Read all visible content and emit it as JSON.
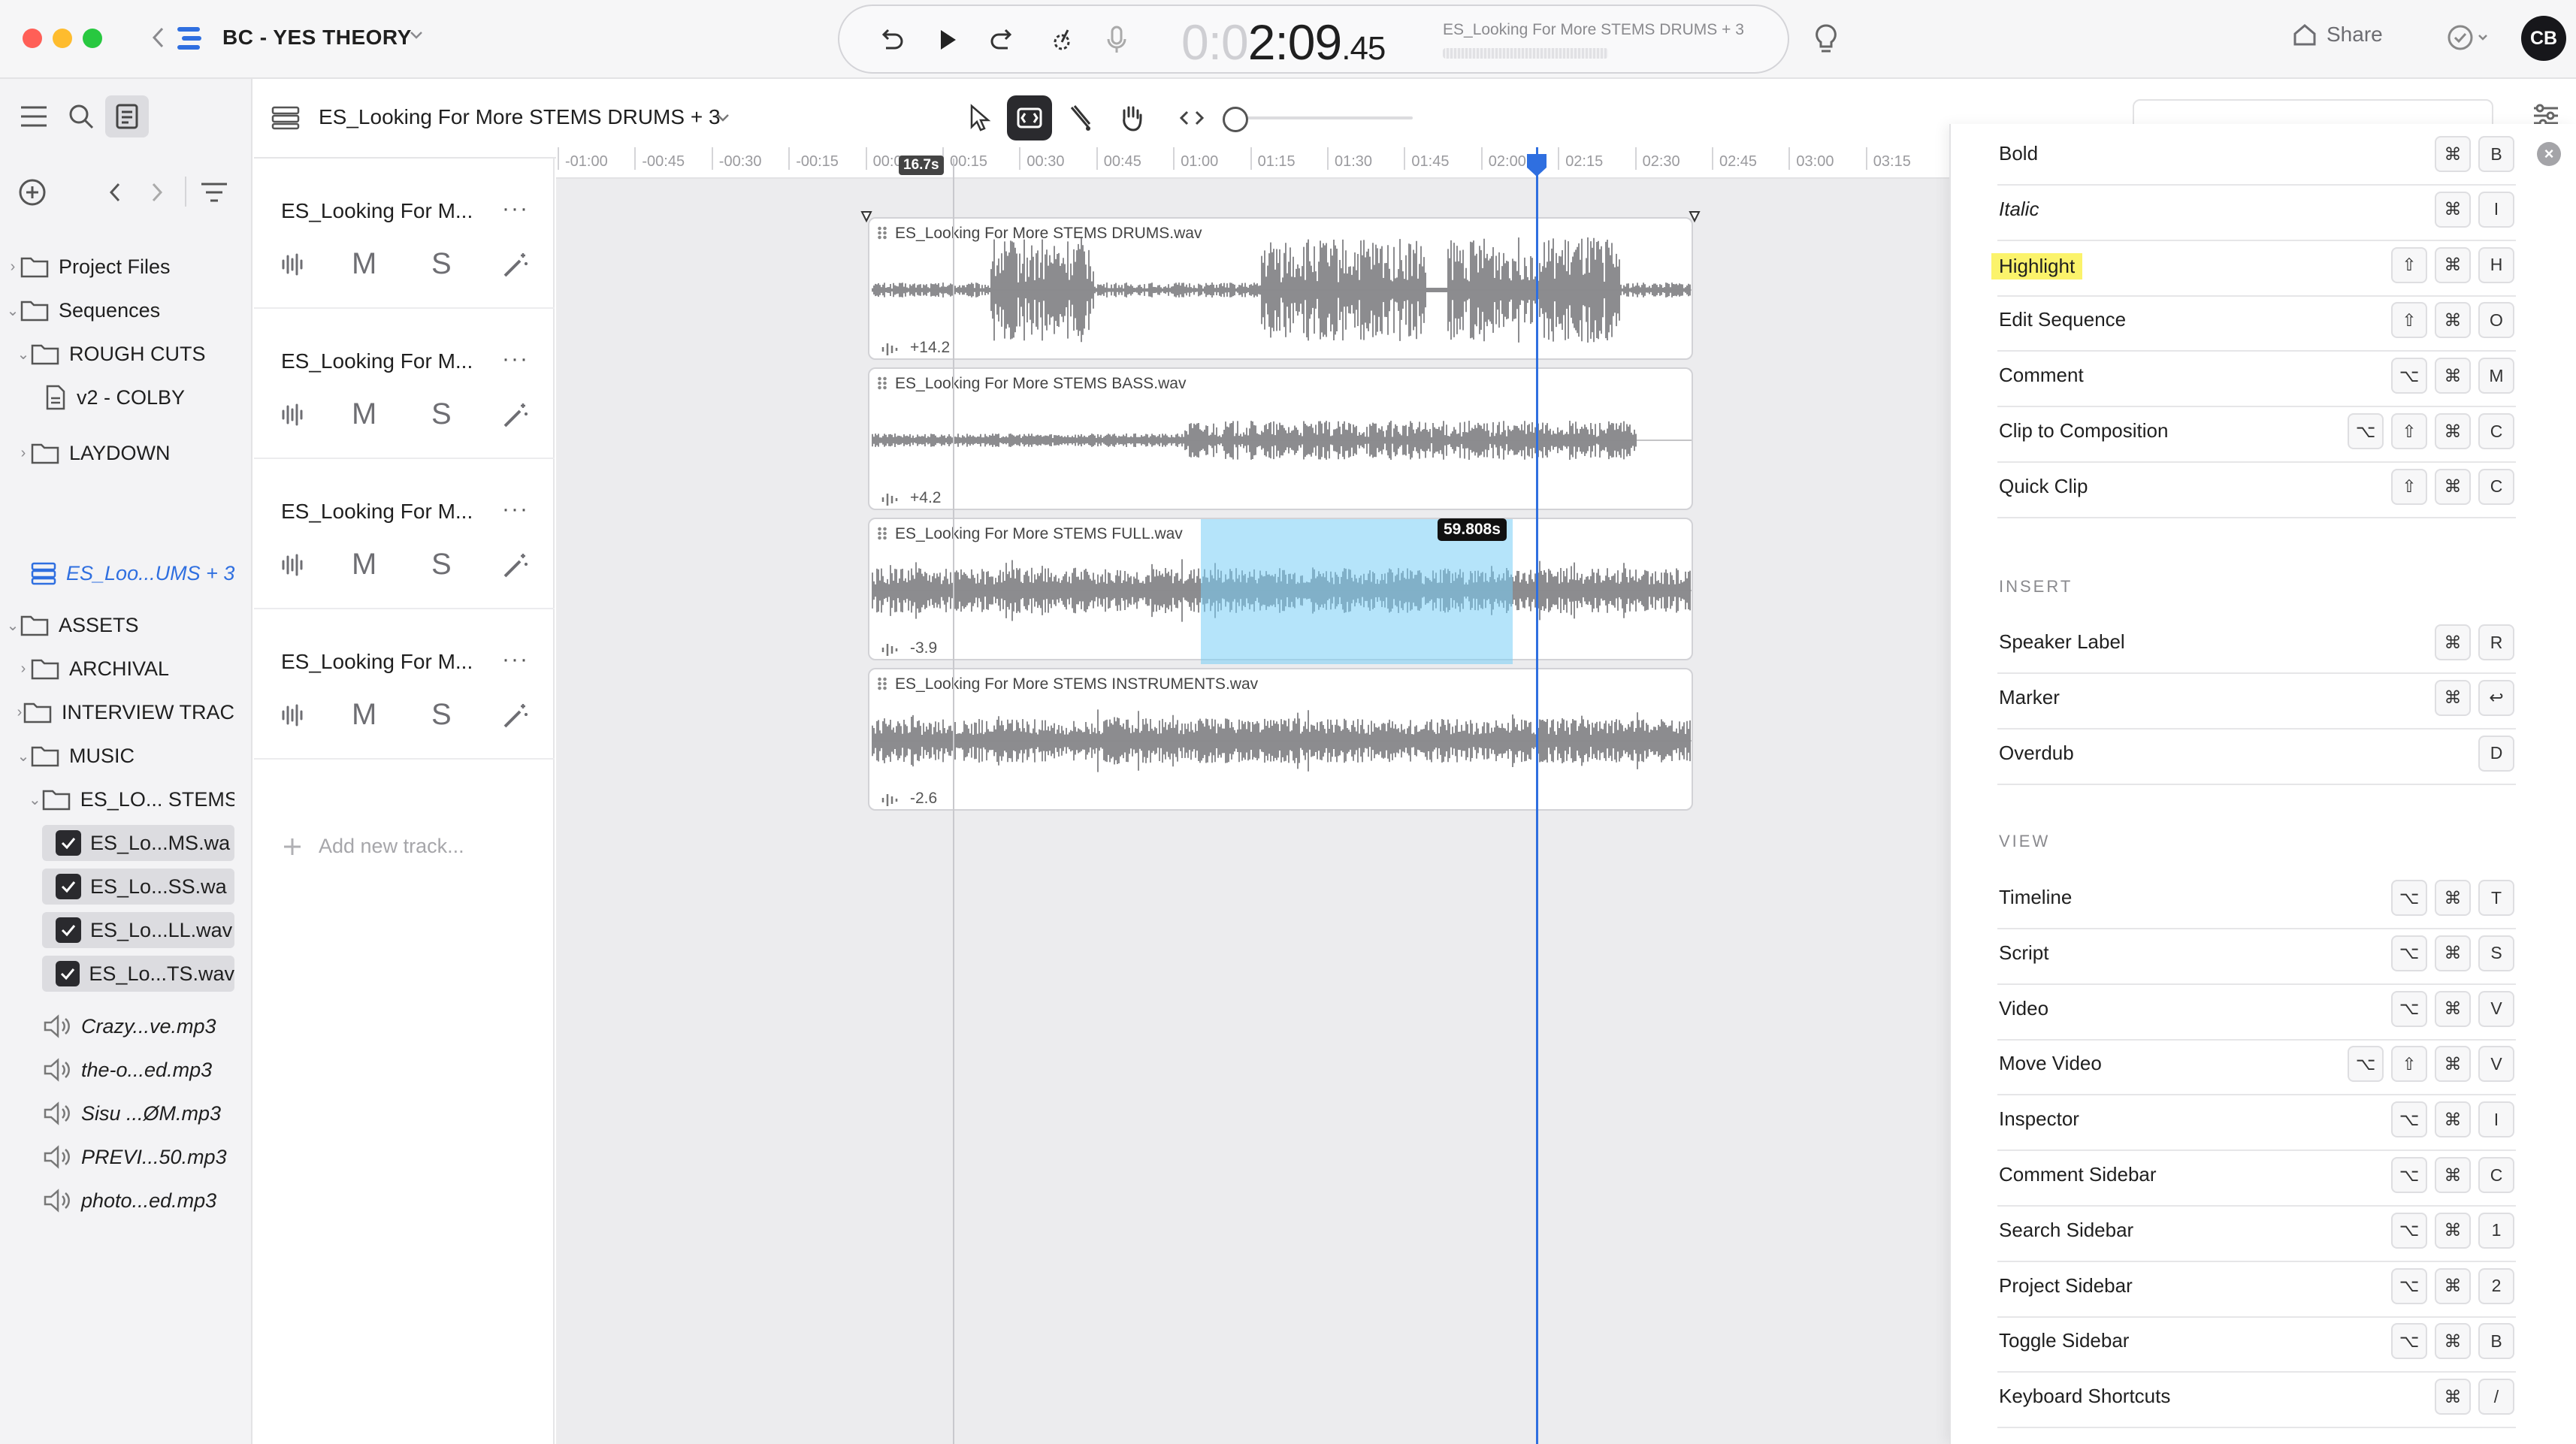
{
  "app": {
    "title": "BC - YES THEORY"
  },
  "transport": {
    "timecode_dim": "0:0",
    "timecode_main": "2:09",
    "timecode_sub": ".45",
    "now_playing": "ES_Looking For More STEMS DRUMS + 3"
  },
  "header": {
    "share_label": "Share",
    "avatar_initials": "CB"
  },
  "sidebar": {
    "items": [
      {
        "label": "Project Files"
      },
      {
        "label": "Sequences"
      },
      {
        "label": "ROUGH CUTS"
      },
      {
        "label": "v2 - COLBY"
      },
      {
        "label": "LAYDOWN"
      },
      {
        "label": "ES_Loo...UMS + 3"
      },
      {
        "label": "ASSETS"
      },
      {
        "label": "ARCHIVAL"
      },
      {
        "label": "INTERVIEW TRAC"
      },
      {
        "label": "MUSIC"
      },
      {
        "label": "ES_LO... STEMS"
      },
      {
        "label": "ES_Lo...MS.wa"
      },
      {
        "label": "ES_Lo...SS.wa"
      },
      {
        "label": "ES_Lo...LL.wav"
      },
      {
        "label": "ES_Lo...TS.wav"
      },
      {
        "label": "Crazy...ve.mp3"
      },
      {
        "label": "the-o...ed.mp3"
      },
      {
        "label": "Sisu ...ØM.mp3"
      },
      {
        "label": "PREVI...50.mp3"
      },
      {
        "label": "photo...ed.mp3"
      }
    ]
  },
  "sequence": {
    "title": "ES_Looking For More STEMS DRUMS + 3"
  },
  "ruler": {
    "ticks": [
      "-01:00",
      "-00:45",
      "-00:30",
      "-00:15",
      "00:00",
      "00:15",
      "00:30",
      "00:45",
      "01:00",
      "01:15",
      "01:30",
      "01:45",
      "02:00",
      "02:15",
      "02:30",
      "02:45",
      "03:00",
      "03:15"
    ],
    "in_badge": "16.7s"
  },
  "tracks": [
    {
      "name": "ES_Looking For M...",
      "clip": "ES_Looking For More STEMS DRUMS.wav",
      "gain": "+14.2"
    },
    {
      "name": "ES_Looking For M...",
      "clip": "ES_Looking For More STEMS BASS.wav",
      "gain": "+4.2"
    },
    {
      "name": "ES_Looking For M...",
      "clip": "ES_Looking For More STEMS FULL.wav",
      "gain": "-3.9"
    },
    {
      "name": "ES_Looking For M...",
      "clip": "ES_Looking For More STEMS INSTRUMENTS.wav",
      "gain": "-2.6"
    }
  ],
  "track_controls": {
    "more": "···",
    "mute": "M",
    "solo": "S"
  },
  "add_track_label": "Add new track...",
  "selection": {
    "duration": "59.808s"
  },
  "shortcuts": {
    "format": [
      {
        "label": "Bold",
        "keys": [
          "⌘",
          "B"
        ]
      },
      {
        "label": "Italic",
        "keys": [
          "⌘",
          "I"
        ]
      },
      {
        "label": "Highlight",
        "keys": [
          "⇧",
          "⌘",
          "H"
        ]
      },
      {
        "label": "Edit Sequence",
        "keys": [
          "⇧",
          "⌘",
          "O"
        ]
      },
      {
        "label": "Comment",
        "keys": [
          "⌥",
          "⌘",
          "M"
        ]
      },
      {
        "label": "Clip to Composition",
        "keys": [
          "⌥",
          "⇧",
          "⌘",
          "C"
        ]
      },
      {
        "label": "Quick Clip",
        "keys": [
          "⇧",
          "⌘",
          "C"
        ]
      }
    ],
    "insert_title": "INSERT",
    "insert": [
      {
        "label": "Speaker Label",
        "keys": [
          "⌘",
          "R"
        ]
      },
      {
        "label": "Marker",
        "keys": [
          "⌘",
          "↩"
        ]
      },
      {
        "label": "Overdub",
        "keys": [
          "D"
        ]
      }
    ],
    "view_title": "VIEW",
    "view": [
      {
        "label": "Timeline",
        "keys": [
          "⌥",
          "⌘",
          "T"
        ]
      },
      {
        "label": "Script",
        "keys": [
          "⌥",
          "⌘",
          "S"
        ]
      },
      {
        "label": "Video",
        "keys": [
          "⌥",
          "⌘",
          "V"
        ]
      },
      {
        "label": "Move Video",
        "keys": [
          "⌥",
          "⇧",
          "⌘",
          "V"
        ]
      },
      {
        "label": "Inspector",
        "keys": [
          "⌥",
          "⌘",
          "I"
        ]
      },
      {
        "label": "Comment Sidebar",
        "keys": [
          "⌥",
          "⌘",
          "C"
        ]
      },
      {
        "label": "Search Sidebar",
        "keys": [
          "⌥",
          "⌘",
          "1"
        ]
      },
      {
        "label": "Project Sidebar",
        "keys": [
          "⌥",
          "⌘",
          "2"
        ]
      },
      {
        "label": "Toggle Sidebar",
        "keys": [
          "⌥",
          "⌘",
          "B"
        ]
      },
      {
        "label": "Keyboard Shortcuts",
        "keys": [
          "⌘",
          "/"
        ]
      }
    ]
  },
  "colors": {
    "accent": "#2f6fe0",
    "highlight": "#fbf36b",
    "selection": "#8fd6f5"
  }
}
